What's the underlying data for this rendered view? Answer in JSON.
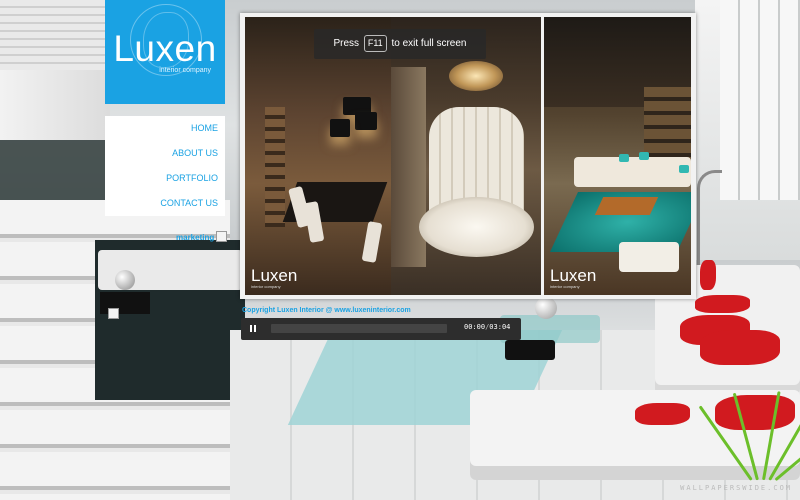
{
  "brand": {
    "name": "Luxen",
    "tagline": "interior company",
    "color": "#1aa2e3"
  },
  "nav": {
    "items": [
      {
        "label": "HOME"
      },
      {
        "label": "ABOUT US"
      },
      {
        "label": "PORTFOLIO"
      },
      {
        "label": "CONTACT US"
      }
    ]
  },
  "sidebar": {
    "marketing_label": "marketing"
  },
  "gallery": {
    "panels": [
      {
        "label": "Luxen",
        "sub": "interior company"
      },
      {
        "label": "",
        "sub": ""
      },
      {
        "label": "Luxen",
        "sub": "interior company"
      }
    ]
  },
  "fullscreen_notice": {
    "prefix": "Press",
    "key": "F11",
    "suffix": "to exit full screen"
  },
  "footer": {
    "copyright": "Copyright Luxen Interior @ www.luxeninterior.com"
  },
  "player": {
    "state": "playing",
    "current_time": "00:00",
    "separator": "/",
    "duration": "03:04",
    "progress": 0.0
  },
  "watermark": "WALLPAPERSWIDE.COM"
}
